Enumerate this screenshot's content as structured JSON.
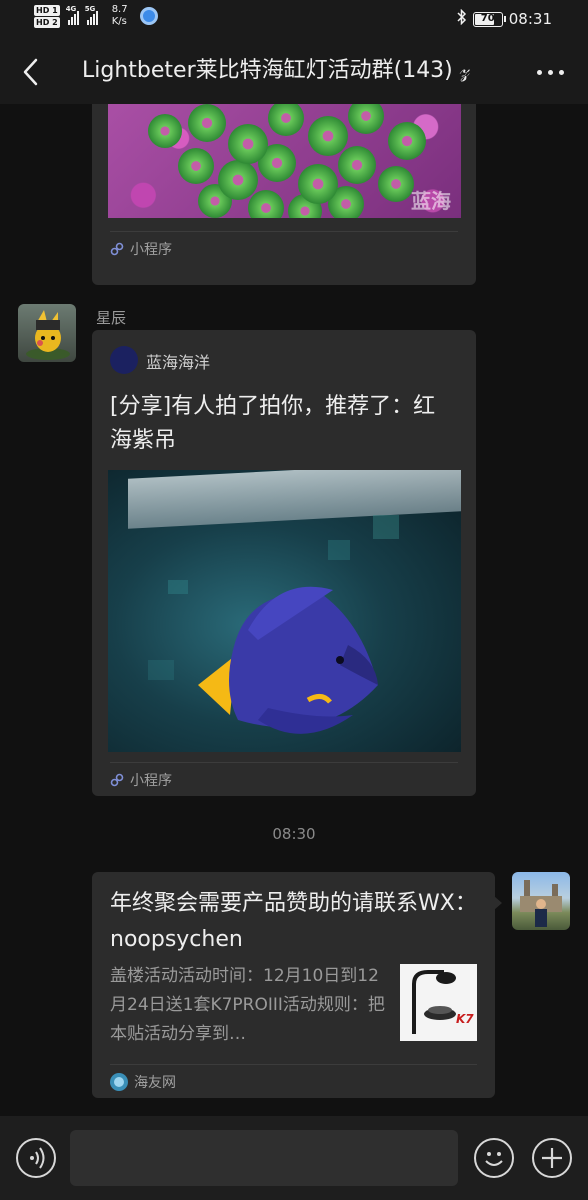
{
  "status_bar": {
    "sim1": "HD 1",
    "sim2": "HD 2",
    "net1": "4G",
    "net2": "5G",
    "speed_value": "8.7",
    "speed_unit": "K/s",
    "battery": "70",
    "battery_level": 0.7,
    "time": "08:31"
  },
  "header": {
    "title": "Lightbeter莱比特海缸灯活动群(143) 𝓏"
  },
  "messages": [
    {
      "type": "mini-program",
      "footer_label": "小程序",
      "image_watermark": "蓝海"
    },
    {
      "type": "mini-program",
      "sender": "星辰",
      "publisher": "蓝海海洋",
      "title": "[分享]有人拍了拍你，推荐了：红海紫吊",
      "footer_label": "小程序"
    },
    {
      "type": "timestamp",
      "text": "08:30"
    },
    {
      "type": "link",
      "title": "年终聚会需要产品赞助的请联系WX：noopsychen",
      "description": "盖楼活动活动时间：12月10日到12月24日送1套K7PROIII活动规则：把本贴活动分享到…",
      "thumb_brand": "K7",
      "source": "海友网"
    }
  ],
  "colors": {
    "background": "#111111",
    "card": "#2c2c2c",
    "bar": "#1a1a1a",
    "text_primary": "#eeeeee",
    "text_secondary": "#9a9a9a"
  },
  "icons": {
    "back": "chevron-left-icon",
    "more": "more-dots-icon",
    "mini_program": "link-icon",
    "voice": "voice-icon",
    "emoji": "emoji-icon",
    "plus": "plus-icon"
  }
}
